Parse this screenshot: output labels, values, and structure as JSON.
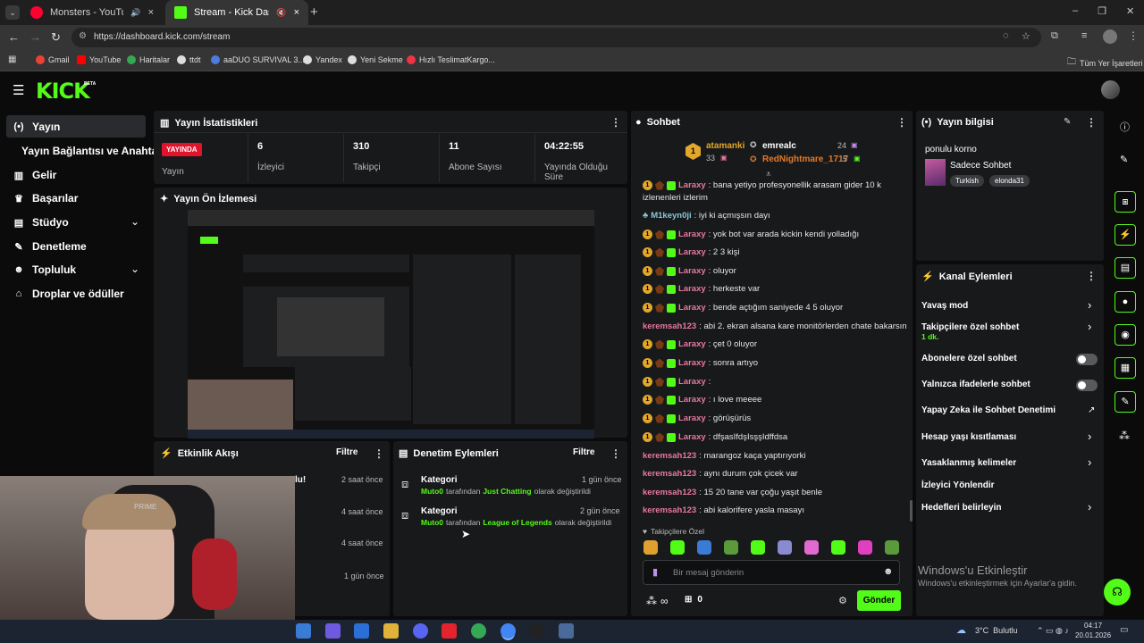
{
  "browser": {
    "tabs": [
      {
        "label": "Monsters - YouTube Music"
      },
      {
        "label": "Stream - Kick Dashboard"
      }
    ],
    "url": "https://dashboard.kick.com/stream",
    "bookmarks": [
      "Gmail",
      "YouTube",
      "Haritalar",
      "ttdt",
      "aaDUO SURVIVAL 3...",
      "Yandex",
      "Yeni Sekme",
      "Hızlı TeslimatKargo..."
    ],
    "all_bookmarks": "Tüm Yer İşaretleri"
  },
  "kick": {
    "logo": "KICK",
    "beta": "BETA"
  },
  "sidebar": {
    "items": [
      {
        "label": "Yayın",
        "icon": "broadcast-icon"
      },
      {
        "label": "Yayın Bağlantısı ve Anahtarı",
        "icon": ""
      },
      {
        "label": "Gelir",
        "icon": "revenue-icon"
      },
      {
        "label": "Başarılar",
        "icon": "trophy-icon"
      },
      {
        "label": "Stüdyo",
        "icon": "studio-icon"
      },
      {
        "label": "Denetleme",
        "icon": "wrench-icon"
      },
      {
        "label": "Topluluk",
        "icon": "community-icon"
      },
      {
        "label": "Droplar ve ödüller",
        "icon": "gift-icon"
      }
    ]
  },
  "stats": {
    "title": "Yayın İstatistikleri",
    "live_badge": "YAYINDA",
    "live_label": "Yayın",
    "items": [
      {
        "value": "6",
        "label": "İzleyici"
      },
      {
        "value": "310",
        "label": "Takipçi"
      },
      {
        "value": "11",
        "label": "Abone Sayısı"
      },
      {
        "value": "04:22:55",
        "label": "Yayında Olduğu Süre"
      }
    ]
  },
  "preview": {
    "title": "Yayın Ön İzlemesi"
  },
  "activity": {
    "title": "Etkinlik Akışı",
    "filter": "Filtre",
    "partial": "lu!",
    "times": [
      "2 saat önce",
      "4 saat önce",
      "4 saat önce",
      "1 gün önce"
    ]
  },
  "moderation": {
    "title": "Denetim Eylemleri",
    "filter": "Filtre",
    "items": [
      {
        "title": "Kategori",
        "time": "1 gün önce",
        "user": "Muto0",
        "mid": "tarafından",
        "target": "Just Chatting",
        "tail": "olarak değiştirildi"
      },
      {
        "title": "Kategori",
        "time": "2 gün önce",
        "user": "Muto0",
        "mid": "tarafından",
        "target": "League of Legends",
        "tail": "olarak değiştirildi"
      }
    ]
  },
  "chat": {
    "title": "Sohbet",
    "top": {
      "rank": "1",
      "user1": "atamanki",
      "count1": "33",
      "user2": "emrealc",
      "count2": "24",
      "user3": "RedNightmare_1717",
      "count3": "5"
    },
    "messages": [
      {
        "user": "Laraxy",
        "text": ": bana yetiyo profesyonellik arasam gider 10 k",
        "badges": true,
        "cls": "un-l"
      },
      {
        "user": "",
        "text": "izlenenleri izlerim",
        "badges": false,
        "cls": "un-l"
      },
      {
        "user": "M1keyn0ji",
        "text": ": iyi ki açmışsın dayı",
        "badges": false,
        "cls": "un-m"
      },
      {
        "user": "Laraxy",
        "text": ": yok bot var arada kickin kendi yolladığı",
        "badges": true,
        "cls": "un-l"
      },
      {
        "user": "Laraxy",
        "text": ": 2 3 kişi",
        "badges": true,
        "cls": "un-l"
      },
      {
        "user": "Laraxy",
        "text": ": oluyor",
        "badges": true,
        "cls": "un-l"
      },
      {
        "user": "Laraxy",
        "text": ": herkeste var",
        "badges": true,
        "cls": "un-l"
      },
      {
        "user": "Laraxy",
        "text": ": bende açtığım saniyede 4 5 oluyor",
        "badges": true,
        "cls": "un-l"
      },
      {
        "user": "keremsah123",
        "text": ": abi 2. ekran alsana kare monitörlerden chate bakarsın",
        "badges": false,
        "cls": "un-k"
      },
      {
        "user": "Laraxy",
        "text": ": çet 0 oluyor",
        "badges": true,
        "cls": "un-l"
      },
      {
        "user": "Laraxy",
        "text": ": sonra artıyo",
        "badges": true,
        "cls": "un-l"
      },
      {
        "user": "Laraxy",
        "text": ":",
        "badges": true,
        "cls": "un-l"
      },
      {
        "user": "Laraxy",
        "text": ": ı love meeee",
        "badges": true,
        "cls": "un-l"
      },
      {
        "user": "Laraxy",
        "text": ": görüşürüs",
        "badges": true,
        "cls": "un-l"
      },
      {
        "user": "Laraxy",
        "text": ": dfşasIfdşIsşşIdffdsa",
        "badges": true,
        "cls": "un-l"
      },
      {
        "user": "keremsah123",
        "text": ": marangoz kaça yaptırıyorki",
        "badges": false,
        "cls": "un-k"
      },
      {
        "user": "keremsah123",
        "text": ": aynı durum çok çicek var",
        "badges": false,
        "cls": "un-k"
      },
      {
        "user": "keremsah123",
        "text": ": 15 20 tane var çoğu yaşıt benle",
        "badges": false,
        "cls": "un-k"
      },
      {
        "user": "keremsah123",
        "text": ": abi kalorifere yasla masayı",
        "badges": false,
        "cls": "un-k"
      }
    ],
    "followers_only": "Takipçilere Özel",
    "placeholder": "Bir mesaj gönderin",
    "infinity": "∞",
    "gift_count": "0",
    "send": "Gönder"
  },
  "stream_info": {
    "title": "Yayın bilgisi",
    "stream_title": "ponulu korno",
    "category": "Sadece Sohbet",
    "tags": [
      "Turkish",
      "elonda31"
    ]
  },
  "channel_actions": {
    "title": "Kanal Eylemleri",
    "items": [
      {
        "label": "Yavaş mod",
        "kind": "chevron"
      },
      {
        "label": "Takipçilere özel sohbet",
        "sub": "1 dk.",
        "kind": "chevron"
      },
      {
        "label": "Abonelere özel sohbet",
        "kind": "toggle"
      },
      {
        "label": "Yalnızca ifadelerle sohbet",
        "kind": "toggle"
      },
      {
        "label": "Yapay Zeka ile Sohbet Denetimi",
        "kind": "external"
      },
      {
        "label": "Hesap yaşı kısıtlaması",
        "kind": "chevron"
      },
      {
        "label": "Yasaklanmış kelimeler",
        "kind": "chevron"
      },
      {
        "label": "İzleyici Yönlendir",
        "kind": "none"
      },
      {
        "label": "Hedefleri belirleyin",
        "kind": "chevron"
      }
    ]
  },
  "windows": {
    "activate_title": "Windows'u Etkinleştir",
    "activate_sub": "Windows'u etkinleştirmek için Ayarlar'a gidin.",
    "weather": "3°C  Bulutlu",
    "time": "04:17",
    "date": "20.01.2026"
  },
  "colors": {
    "accent": "#53fc18",
    "live": "#e1142b",
    "panel": "#18191b"
  }
}
